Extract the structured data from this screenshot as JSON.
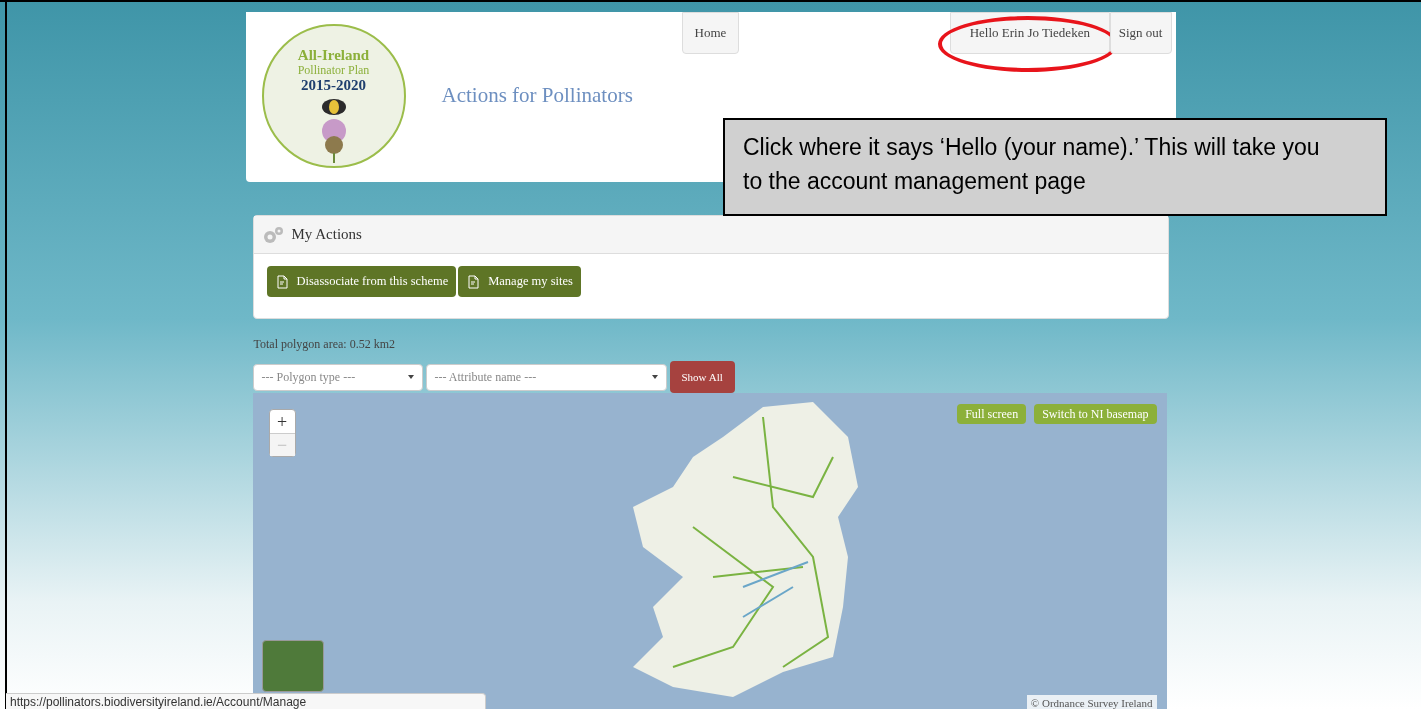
{
  "header": {
    "logo": {
      "title": "All-Ireland",
      "subtitle": "Pollinator Plan",
      "years": "2015-2020"
    },
    "site_title": "Actions for Pollinators",
    "nav": [
      {
        "label": "Home",
        "highlighted": false
      },
      {
        "label": "Hello Erin Jo Tiedeken",
        "highlighted": true
      },
      {
        "label": "Sign out",
        "highlighted": false
      }
    ]
  },
  "callout": {
    "text": "Click where it says ‘Hello (your name).’ This will take you to the account management page"
  },
  "panel": {
    "title": "My Actions",
    "buttons": [
      "Disassociate from this scheme",
      "Manage my sites"
    ]
  },
  "total_area": "Total polygon area: 0.52 km2",
  "filters": [
    {
      "placeholder": "--- Polygon type ---"
    },
    {
      "placeholder": "--- Attribute name ---"
    }
  ],
  "show_all": "Show All",
  "map": {
    "zoom_in": "+",
    "zoom_out": "−",
    "buttons": [
      "Full screen",
      "Switch to NI basemap"
    ],
    "attribution": "© Ordnance Survey Ireland"
  },
  "status_bar": "https://pollinators.biodiversityireland.ie/Account/Manage"
}
